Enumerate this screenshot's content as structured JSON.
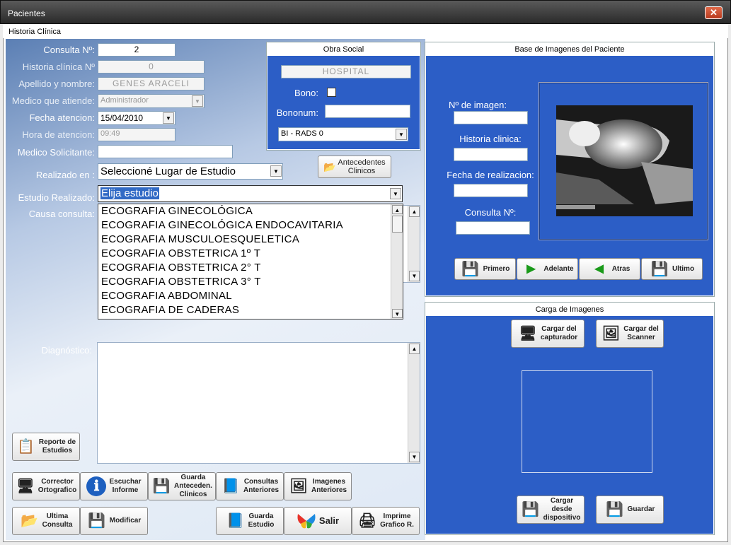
{
  "window": {
    "title": "Pacientes",
    "close_label": "✕"
  },
  "tab": {
    "label": "Historia Clínica"
  },
  "form": {
    "consulta_label": "Consulta Nº:",
    "consulta_value": "2",
    "historia_label": "Historia clínica Nº",
    "historia_value": "0",
    "apellido_label": "Apellido y nombre:",
    "apellido_value": "GENES  ARACELI",
    "medico_label": "Medico que atiende:",
    "medico_value": "Administrador",
    "fecha_label": "Fecha atencion:",
    "fecha_value": "15/04/2010",
    "hora_label": "Hora de atencion:",
    "hora_value": "09:49",
    "solicitante_label": "Medico Solicitante:",
    "solicitante_value": "",
    "realizado_label": "Realizado en :",
    "realizado_value": "Seleccioné Lugar de Estudio",
    "estudio_label": "Estudio Realizado:",
    "estudio_value": "Elija estudio",
    "causa_label": "Causa consulta:",
    "diagnostico_label": "Diagnóstico:"
  },
  "estudio_options": [
    "ECOGRAFIA  GINECOLÓGICA",
    "ECOGRAFIA  GINECOLÓGICA ENDOCAVITARIA",
    "ECOGRAFIA  MUSCULOESQUELETICA",
    "ECOGRAFIA  OBSTETRICA 1º T",
    "ECOGRAFIA  OBSTETRICA 2° T",
    "ECOGRAFIA  OBSTETRICA 3° T",
    "ECOGRAFIA ABDOMINAL",
    "ECOGRAFIA DE CADERAS"
  ],
  "obra_social": {
    "title": "Obra Social",
    "name": "HOSPITAL",
    "bono_label": "Bono:",
    "bononum_label": "Bononum:",
    "bononum_value": "",
    "birads_value": "BI - RADS 0"
  },
  "antecedentes_btn": {
    "line1": "Antecedentes",
    "line2": "Clinicos"
  },
  "imagenes": {
    "title": "Base de Imagenes del Paciente",
    "nro_label": "Nº de imagen:",
    "historia_label": "Historia clinica:",
    "fecha_label": "Fecha de realizacion:",
    "consulta_label": "Consulta Nº:",
    "nav": {
      "primero": "Primero",
      "adelante": "Adelante",
      "atras": "Atras",
      "ultimo": "Ultimo"
    }
  },
  "carga": {
    "title": "Carga de Imagenes",
    "capturador": {
      "line1": "Cargar del",
      "line2": "capturador"
    },
    "scanner": {
      "line1": "Cargar del",
      "line2": "Scanner"
    },
    "dispositivo": {
      "line1": "Cargar",
      "line2": "desde",
      "line3": "dispositivo"
    },
    "guardar": "Guardar"
  },
  "buttons": {
    "reporte": {
      "line1": "Reporte de",
      "line2": "Estudios"
    },
    "corrector": {
      "line1": "Corrector",
      "line2": "Ortografico"
    },
    "escuchar": {
      "line1": "Escuchar",
      "line2": "Informe"
    },
    "guarda_ant": {
      "line1": "Guarda",
      "line2": "Anteceden.",
      "line3": "Clinicos"
    },
    "consultas": {
      "line1": "Consultas",
      "line2": "Anteriores"
    },
    "imagenes_ant": {
      "line1": "Imagenes",
      "line2": "Anteriores"
    },
    "ultima": {
      "line1": "Ultima",
      "line2": "Consulta"
    },
    "modificar": "Modificar",
    "guarda_estudio": {
      "line1": "Guarda",
      "line2": "Estudio"
    },
    "salir": "Salir",
    "imprime": {
      "line1": "Imprime",
      "line2": "Grafico R."
    }
  },
  "icons": {
    "scroll_up": "▲",
    "scroll_down": "▼",
    "dropdown": "▼",
    "next": "▶",
    "prev": "◀",
    "folder": "📂",
    "monitor": "🖥",
    "info": "ℹ",
    "disk": "💾",
    "images": "🖼",
    "printer": "🖨",
    "book": "📘",
    "report": "📋"
  },
  "colors": {
    "panel_blue": "#2c5ec6",
    "left_gradient_top": "#5b7fb4"
  }
}
